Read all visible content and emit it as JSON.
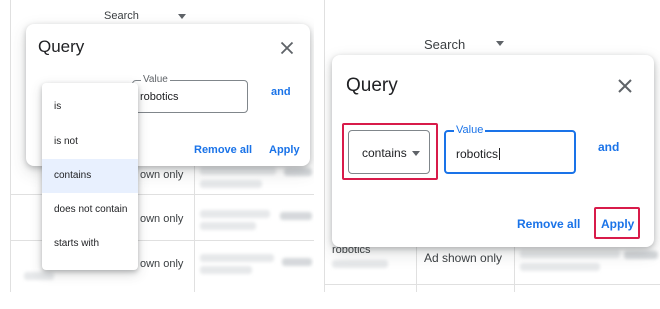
{
  "left": {
    "background": {
      "search_header": "Search",
      "row_labels": [
        "own only",
        "own only",
        "own only"
      ]
    },
    "dialog": {
      "title": "Query",
      "value_label": "Value",
      "value": "robotics",
      "and_label": "and",
      "remove_all_label": "Remove all",
      "apply_label": "Apply"
    },
    "operator_menu": {
      "selected": "contains",
      "options": [
        "is",
        "is not",
        "contains",
        "does not contain",
        "starts with"
      ]
    }
  },
  "right": {
    "background": {
      "search_header": "Search",
      "row_term": "robotics",
      "row_status": "Ad shown only"
    },
    "dialog": {
      "title": "Query",
      "operator_value": "contains",
      "value_label": "Value",
      "value": "robotics",
      "and_label": "and",
      "remove_all_label": "Remove all",
      "apply_label": "Apply"
    }
  },
  "colors": {
    "accent": "#1a73e8",
    "highlight": "#d81b4a",
    "menu_selected_bg": "#e8f0fe"
  },
  "icons": {
    "close": "close-icon",
    "dropdown": "caret-down-icon"
  }
}
